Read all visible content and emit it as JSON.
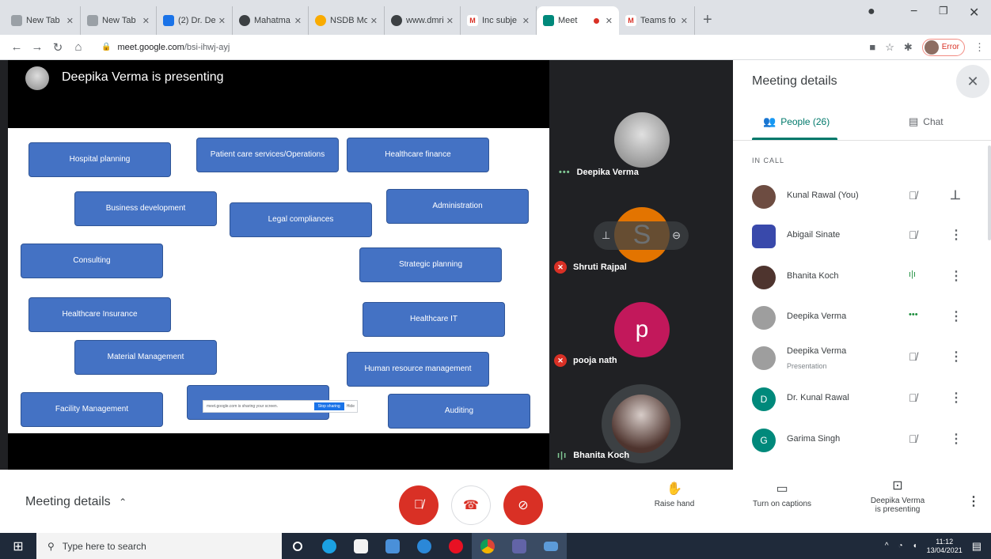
{
  "browser": {
    "tabs": [
      {
        "title": "New Tab",
        "color": "#9aa0a6"
      },
      {
        "title": "New Tab",
        "color": "#9aa0a6"
      },
      {
        "title": "(2) Dr. Dee",
        "color": "#1a73e8"
      },
      {
        "title": "Mahatma",
        "color": "#3c4043"
      },
      {
        "title": "NSDB Mo",
        "color": "#f9ab00"
      },
      {
        "title": "www.dmri",
        "color": "#3c4043"
      },
      {
        "title": "Inc subje",
        "color": "#d93025"
      }
    ],
    "active_tab": {
      "title": "Meet",
      "color": "#00897b"
    },
    "last_tab": {
      "title": "Teams fo",
      "color": "#d93025"
    },
    "url_host": "meet.google.com",
    "url_path": "/bsi-ihwj-ayj",
    "profile_label": "Error"
  },
  "presentation": {
    "presenter_title": "Deepika Verma is presenting",
    "slide_boxes": [
      "Hospital planning",
      "Patient care services/Operations",
      "Healthcare finance",
      "Business development",
      "Legal compliances",
      "Administration",
      "Consulting",
      "Strategic planning",
      "Healthcare Insurance",
      "Healthcare IT",
      "Material Management",
      "Human resource management",
      "Facility Management",
      "Auditing"
    ],
    "share_bar": {
      "text": "meet.google.com is sharing your screen.",
      "stop": "Stop sharing",
      "hide": "Hide"
    }
  },
  "tiles": [
    {
      "name": "Deepika Verma"
    },
    {
      "name": "Shruti Rajpal",
      "initial": "S",
      "color": "#e37400"
    },
    {
      "name": "pooja nath",
      "initial": "p",
      "color": "#c2185b"
    },
    {
      "name": "Bhanita Koch"
    }
  ],
  "panel": {
    "title": "Meeting details",
    "tab_people": "People (26)",
    "tab_chat": "Chat",
    "section": "IN CALL",
    "people": [
      {
        "name": "Kunal Rawal (You)",
        "sub": "",
        "avatar": "",
        "color": "#6d4c41"
      },
      {
        "name": "Abigail Sinate",
        "sub": "",
        "avatar": "",
        "color": "#3949ab"
      },
      {
        "name": "Bhanita Koch",
        "sub": "",
        "avatar": "",
        "color": "#4e342e"
      },
      {
        "name": "Deepika Verma",
        "sub": "",
        "avatar": "",
        "color": "#9e9e9e"
      },
      {
        "name": "Deepika Verma",
        "sub": "Presentation",
        "avatar": "",
        "color": "#9e9e9e"
      },
      {
        "name": "Dr. Kunal Rawal",
        "sub": "",
        "avatar": "D",
        "color": "#00897b"
      },
      {
        "name": "Garima Singh",
        "sub": "",
        "avatar": "G",
        "color": "#00897b"
      }
    ]
  },
  "bottom": {
    "meeting_details": "Meeting details",
    "raise_hand": "Raise hand",
    "captions": "Turn on captions",
    "presenting_1": "Deepika Verma",
    "presenting_2": "is presenting"
  },
  "taskbar": {
    "search": "Type here to search",
    "time": "11:12",
    "date": "13/04/2021"
  }
}
